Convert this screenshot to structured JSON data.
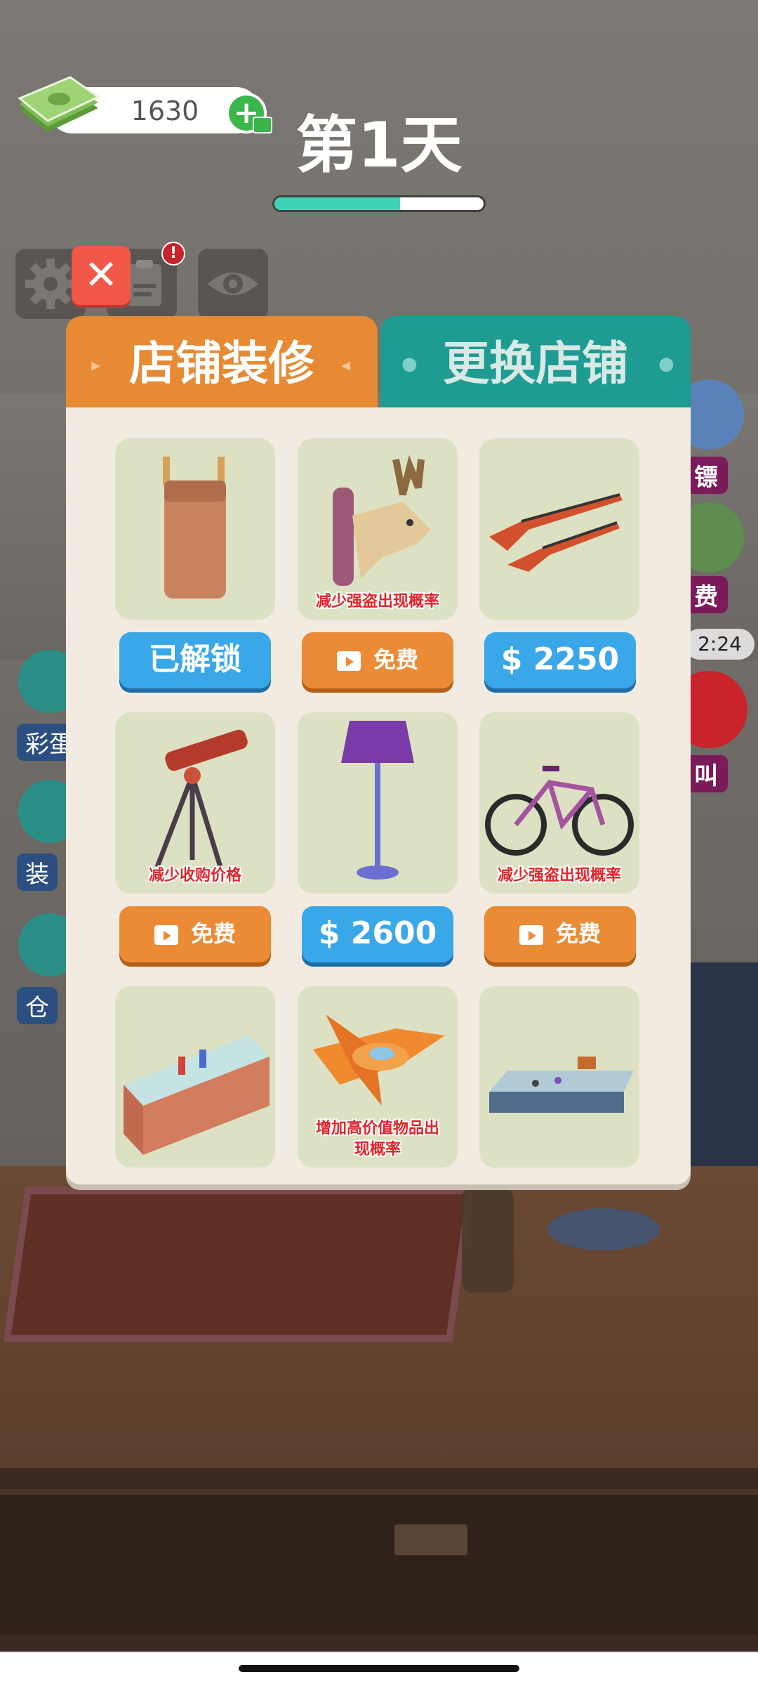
{
  "hud": {
    "money": "1630",
    "day_title": "第1天",
    "day_progress": 0.6,
    "notification_badge": "!",
    "close_symbol": "✕"
  },
  "tabs": [
    {
      "label": "店铺装修",
      "active": true
    },
    {
      "label": "更换店铺",
      "active": false
    }
  ],
  "items": [
    {
      "icon": "knife-block-icon",
      "caption": "",
      "button": {
        "type": "unlocked",
        "label": "已解锁"
      }
    },
    {
      "icon": "deer-head-trophy-icon",
      "caption": "减少强盗出现概率",
      "button": {
        "type": "free",
        "label": "免费"
      }
    },
    {
      "icon": "rifles-icon",
      "caption": "",
      "button": {
        "type": "price",
        "label": "$ 2250"
      }
    },
    {
      "icon": "telescope-icon",
      "caption": "减少收购价格",
      "button": {
        "type": "free",
        "label": "免费"
      }
    },
    {
      "icon": "floor-lamp-icon",
      "caption": "",
      "button": {
        "type": "price",
        "label": "$ 2600"
      }
    },
    {
      "icon": "bicycle-icon",
      "caption": "减少强盗出现概率",
      "button": {
        "type": "free",
        "label": "免费"
      }
    },
    {
      "icon": "display-cabinet-icon",
      "caption": "",
      "button": null
    },
    {
      "icon": "airplane-icon",
      "caption": "增加高价值物品出现概率",
      "button": null
    },
    {
      "icon": "glass-counter-icon",
      "caption": "",
      "button": null
    }
  ],
  "side_left": [
    "彩蛋",
    "装",
    "仓"
  ],
  "side_right": [
    "镖",
    "费",
    "叫"
  ],
  "timer": "2:24",
  "colors": {
    "tab_active": "#e68a34",
    "tab_inactive": "#1e9c92",
    "button_blue": "#3aa8e8",
    "button_orange": "#ec8b35",
    "progress": "#3fd1b3"
  }
}
